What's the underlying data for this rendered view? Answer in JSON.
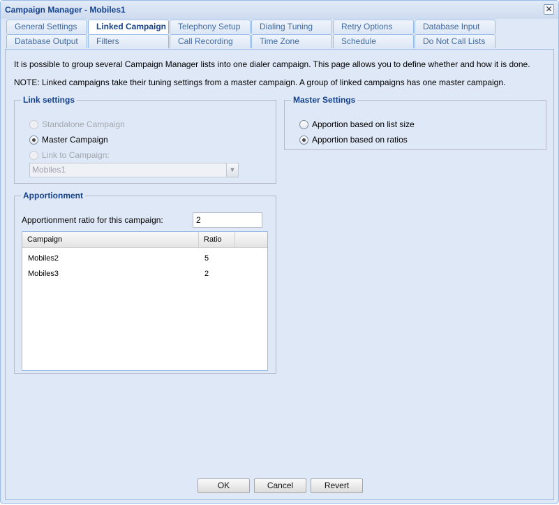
{
  "window": {
    "title": "Campaign Manager - Mobiles1",
    "close_glyph": "✕"
  },
  "tabs_row1": [
    {
      "label": "General Settings",
      "active": false
    },
    {
      "label": "Linked Campaign",
      "active": true
    },
    {
      "label": "Telephony Setup",
      "active": false
    },
    {
      "label": "Dialing Tuning",
      "active": false
    },
    {
      "label": "Retry Options",
      "active": false
    },
    {
      "label": "Database Input",
      "active": false
    }
  ],
  "tabs_row2": [
    {
      "label": "Database Output"
    },
    {
      "label": "Filters"
    },
    {
      "label": "Call Recording"
    },
    {
      "label": "Time Zone"
    },
    {
      "label": "Schedule"
    },
    {
      "label": "Do Not Call Lists"
    }
  ],
  "intro": {
    "line1": "It is possible to group several Campaign Manager lists into one dialer campaign. This page allows you to define whether and how it is done.",
    "line2": "NOTE: Linked campaigns take their tuning settings from a master campaign. A group of linked campaigns has one master campaign."
  },
  "link_settings": {
    "legend": "Link settings",
    "standalone": "Standalone Campaign",
    "master": "Master Campaign",
    "link_to": "Link to Campaign:",
    "combo_value": "Mobiles1",
    "selected": "master"
  },
  "master_settings": {
    "legend": "Master Settings",
    "by_list_size": "Apportion based on list size",
    "by_ratios": "Apportion based on ratios",
    "selected": "ratios"
  },
  "apportionment": {
    "legend": "Apportionment",
    "ratio_label": "Apportionment ratio for this campaign:",
    "ratio_value": "2",
    "columns": [
      "Campaign",
      "Ratio"
    ],
    "rows": [
      {
        "campaign": "Mobiles2",
        "ratio": "5"
      },
      {
        "campaign": "Mobiles3",
        "ratio": "2"
      }
    ]
  },
  "buttons": {
    "ok": "OK",
    "cancel": "Cancel",
    "revert": "Revert"
  }
}
